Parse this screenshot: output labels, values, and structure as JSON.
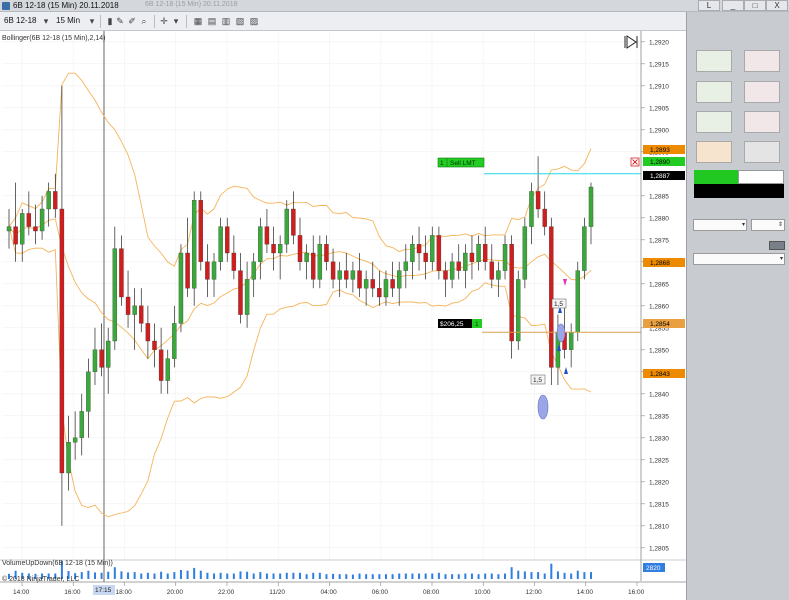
{
  "window": {
    "title": "6B 12-18 (15 Min)  20.11.2018",
    "ghost_title": "6B 12-18 (15 Min)  20.11.2018",
    "minimize": "_",
    "maximize": "□",
    "close": "X",
    "lock": "L"
  },
  "toolbar": {
    "instrument": "6B 12-18",
    "interval": "15 Min"
  },
  "chart": {
    "indicator_label": "Bollinger(6B 12-18 (15 Min),2,14)",
    "volume_label": "VolumeUpDown(6B 12-18 (15 Min))",
    "copyright": "© 2018 NinjaTrader, LLC",
    "price_axis_labels": [
      "1,2920",
      "1,2915",
      "1,2910",
      "1,2905",
      "1,2900",
      "1,2895",
      "1,2885",
      "1,2880",
      "1,2875",
      "1,2870",
      "1,2865",
      "1,2860",
      "1,2855",
      "1,2850",
      "1,2845",
      "1,2840",
      "1,2835",
      "1,2830",
      "1,2825",
      "1,2820",
      "1,2815",
      "1,2810",
      "1,2805"
    ],
    "price_markers": {
      "upper_band": "1,2893",
      "limit_order": "1,2890",
      "last_price": "1,2887",
      "middle_band": "1,2868",
      "entry_price": "1,2854",
      "lower_band": "1,2843"
    },
    "volume_axis_label": "2820",
    "time_axis_labels": [
      "14:00",
      "16:00",
      "18:00",
      "20:00",
      "22:00",
      "11/20",
      "04:00",
      "06:00",
      "08:00",
      "10:00",
      "12:00",
      "14:00",
      "16:00"
    ],
    "crosshair_time": "17:15",
    "order_label": {
      "qty": "1",
      "text": "Sell LMT"
    },
    "position_label": {
      "pnl": "$206,25",
      "qty": "1"
    },
    "exec_labels": {
      "a": "1,5",
      "b": "1,5"
    },
    "colors": {
      "up_candle": "#3aa83a",
      "down_candle": "#d01d1d",
      "band": "#f5b45a",
      "limit_line": "#20d8e8",
      "entry_line": "#d8a050",
      "volume": "#2f7ee0",
      "order_tag": "#22cc22",
      "band_tag": "#ee8a00"
    }
  },
  "chart_data": {
    "type": "candlestick",
    "instrument": "6B 12-18",
    "interval": "15 Min",
    "y_range": [
      1.2802,
      1.2922
    ],
    "x_labels": [
      "14:00",
      "16:00",
      "18:00",
      "20:00",
      "22:00",
      "11/20",
      "04:00",
      "06:00",
      "08:00",
      "10:00",
      "12:00",
      "14:00",
      "16:00"
    ],
    "candles": [
      {
        "o": 1.2877,
        "h": 1.2882,
        "l": 1.2873,
        "c": 1.2878
      },
      {
        "o": 1.2878,
        "h": 1.2888,
        "l": 1.287,
        "c": 1.2874
      },
      {
        "o": 1.2874,
        "h": 1.2882,
        "l": 1.287,
        "c": 1.2881
      },
      {
        "o": 1.2881,
        "h": 1.2886,
        "l": 1.2876,
        "c": 1.2878
      },
      {
        "o": 1.2878,
        "h": 1.2883,
        "l": 1.2874,
        "c": 1.2877
      },
      {
        "o": 1.2877,
        "h": 1.2885,
        "l": 1.2875,
        "c": 1.2882
      },
      {
        "o": 1.2882,
        "h": 1.2888,
        "l": 1.2878,
        "c": 1.2886
      },
      {
        "o": 1.2886,
        "h": 1.289,
        "l": 1.288,
        "c": 1.2882
      },
      {
        "o": 1.2882,
        "h": 1.291,
        "l": 1.281,
        "c": 1.2822
      },
      {
        "o": 1.2822,
        "h": 1.2835,
        "l": 1.2818,
        "c": 1.2829
      },
      {
        "o": 1.2829,
        "h": 1.2836,
        "l": 1.2825,
        "c": 1.283
      },
      {
        "o": 1.283,
        "h": 1.284,
        "l": 1.2826,
        "c": 1.2836
      },
      {
        "o": 1.2836,
        "h": 1.2848,
        "l": 1.283,
        "c": 1.2845
      },
      {
        "o": 1.2845,
        "h": 1.2855,
        "l": 1.2842,
        "c": 1.285
      },
      {
        "o": 1.285,
        "h": 1.2856,
        "l": 1.2844,
        "c": 1.2846
      },
      {
        "o": 1.2846,
        "h": 1.2855,
        "l": 1.284,
        "c": 1.2852
      },
      {
        "o": 1.2852,
        "h": 1.2878,
        "l": 1.285,
        "c": 1.2873
      },
      {
        "o": 1.2873,
        "h": 1.2876,
        "l": 1.286,
        "c": 1.2862
      },
      {
        "o": 1.2862,
        "h": 1.2868,
        "l": 1.2855,
        "c": 1.2858
      },
      {
        "o": 1.2858,
        "h": 1.2864,
        "l": 1.285,
        "c": 1.286
      },
      {
        "o": 1.286,
        "h": 1.2864,
        "l": 1.2854,
        "c": 1.2856
      },
      {
        "o": 1.2856,
        "h": 1.286,
        "l": 1.2848,
        "c": 1.2852
      },
      {
        "o": 1.2852,
        "h": 1.2856,
        "l": 1.2846,
        "c": 1.285
      },
      {
        "o": 1.285,
        "h": 1.2855,
        "l": 1.284,
        "c": 1.2843
      },
      {
        "o": 1.2843,
        "h": 1.285,
        "l": 1.284,
        "c": 1.2848
      },
      {
        "o": 1.2848,
        "h": 1.286,
        "l": 1.2846,
        "c": 1.2856
      },
      {
        "o": 1.2856,
        "h": 1.2874,
        "l": 1.2854,
        "c": 1.2872
      },
      {
        "o": 1.2872,
        "h": 1.288,
        "l": 1.2862,
        "c": 1.2864
      },
      {
        "o": 1.2864,
        "h": 1.2886,
        "l": 1.286,
        "c": 1.2884
      },
      {
        "o": 1.2884,
        "h": 1.2886,
        "l": 1.2868,
        "c": 1.287
      },
      {
        "o": 1.287,
        "h": 1.2874,
        "l": 1.2862,
        "c": 1.2866
      },
      {
        "o": 1.2866,
        "h": 1.2872,
        "l": 1.2862,
        "c": 1.287
      },
      {
        "o": 1.287,
        "h": 1.288,
        "l": 1.2868,
        "c": 1.2878
      },
      {
        "o": 1.2878,
        "h": 1.288,
        "l": 1.287,
        "c": 1.2872
      },
      {
        "o": 1.2872,
        "h": 1.2876,
        "l": 1.2866,
        "c": 1.2868
      },
      {
        "o": 1.2868,
        "h": 1.2872,
        "l": 1.2856,
        "c": 1.2858
      },
      {
        "o": 1.2858,
        "h": 1.287,
        "l": 1.2855,
        "c": 1.2866
      },
      {
        "o": 1.2866,
        "h": 1.2872,
        "l": 1.2862,
        "c": 1.287
      },
      {
        "o": 1.287,
        "h": 1.288,
        "l": 1.2866,
        "c": 1.2878
      },
      {
        "o": 1.2878,
        "h": 1.2882,
        "l": 1.2872,
        "c": 1.2874
      },
      {
        "o": 1.2874,
        "h": 1.2878,
        "l": 1.2868,
        "c": 1.2872
      },
      {
        "o": 1.2872,
        "h": 1.2876,
        "l": 1.2866,
        "c": 1.2874
      },
      {
        "o": 1.2874,
        "h": 1.2884,
        "l": 1.2872,
        "c": 1.2882
      },
      {
        "o": 1.2882,
        "h": 1.2886,
        "l": 1.2874,
        "c": 1.2876
      },
      {
        "o": 1.2876,
        "h": 1.288,
        "l": 1.2868,
        "c": 1.287
      },
      {
        "o": 1.287,
        "h": 1.2874,
        "l": 1.2866,
        "c": 1.2872
      },
      {
        "o": 1.2872,
        "h": 1.2876,
        "l": 1.2864,
        "c": 1.2866
      },
      {
        "o": 1.2866,
        "h": 1.2876,
        "l": 1.2864,
        "c": 1.2874
      },
      {
        "o": 1.2874,
        "h": 1.2876,
        "l": 1.2868,
        "c": 1.287
      },
      {
        "o": 1.287,
        "h": 1.2873,
        "l": 1.2864,
        "c": 1.2866
      },
      {
        "o": 1.2866,
        "h": 1.287,
        "l": 1.2862,
        "c": 1.2868
      },
      {
        "o": 1.2868,
        "h": 1.2872,
        "l": 1.2864,
        "c": 1.2866
      },
      {
        "o": 1.2866,
        "h": 1.287,
        "l": 1.2863,
        "c": 1.2868
      },
      {
        "o": 1.2868,
        "h": 1.2872,
        "l": 1.2862,
        "c": 1.2864
      },
      {
        "o": 1.2864,
        "h": 1.2868,
        "l": 1.286,
        "c": 1.2866
      },
      {
        "o": 1.2866,
        "h": 1.287,
        "l": 1.2862,
        "c": 1.2864
      },
      {
        "o": 1.2864,
        "h": 1.2868,
        "l": 1.286,
        "c": 1.2862
      },
      {
        "o": 1.2862,
        "h": 1.2868,
        "l": 1.286,
        "c": 1.2866
      },
      {
        "o": 1.2866,
        "h": 1.287,
        "l": 1.2862,
        "c": 1.2864
      },
      {
        "o": 1.2864,
        "h": 1.287,
        "l": 1.286,
        "c": 1.2868
      },
      {
        "o": 1.2868,
        "h": 1.2874,
        "l": 1.2864,
        "c": 1.287
      },
      {
        "o": 1.287,
        "h": 1.2876,
        "l": 1.2866,
        "c": 1.2874
      },
      {
        "o": 1.2874,
        "h": 1.2878,
        "l": 1.2868,
        "c": 1.2872
      },
      {
        "o": 1.2872,
        "h": 1.2876,
        "l": 1.2866,
        "c": 1.287
      },
      {
        "o": 1.287,
        "h": 1.2878,
        "l": 1.2868,
        "c": 1.2876
      },
      {
        "o": 1.2876,
        "h": 1.2878,
        "l": 1.2866,
        "c": 1.2868
      },
      {
        "o": 1.2868,
        "h": 1.287,
        "l": 1.2862,
        "c": 1.2866
      },
      {
        "o": 1.2866,
        "h": 1.2872,
        "l": 1.2864,
        "c": 1.287
      },
      {
        "o": 1.287,
        "h": 1.2874,
        "l": 1.2866,
        "c": 1.2868
      },
      {
        "o": 1.2868,
        "h": 1.2874,
        "l": 1.2864,
        "c": 1.2872
      },
      {
        "o": 1.2872,
        "h": 1.2876,
        "l": 1.2866,
        "c": 1.287
      },
      {
        "o": 1.287,
        "h": 1.2876,
        "l": 1.2868,
        "c": 1.2874
      },
      {
        "o": 1.2874,
        "h": 1.2878,
        "l": 1.2868,
        "c": 1.287
      },
      {
        "o": 1.287,
        "h": 1.2874,
        "l": 1.2864,
        "c": 1.2866
      },
      {
        "o": 1.2866,
        "h": 1.287,
        "l": 1.2862,
        "c": 1.2868
      },
      {
        "o": 1.2868,
        "h": 1.2876,
        "l": 1.2866,
        "c": 1.2874
      },
      {
        "o": 1.2874,
        "h": 1.2876,
        "l": 1.2848,
        "c": 1.2852
      },
      {
        "o": 1.2852,
        "h": 1.2868,
        "l": 1.285,
        "c": 1.2866
      },
      {
        "o": 1.2866,
        "h": 1.288,
        "l": 1.2864,
        "c": 1.2878
      },
      {
        "o": 1.2878,
        "h": 1.2888,
        "l": 1.2874,
        "c": 1.2886
      },
      {
        "o": 1.2886,
        "h": 1.2894,
        "l": 1.288,
        "c": 1.2882
      },
      {
        "o": 1.2882,
        "h": 1.2886,
        "l": 1.2876,
        "c": 1.2878
      },
      {
        "o": 1.2878,
        "h": 1.288,
        "l": 1.2842,
        "c": 1.2846
      },
      {
        "o": 1.2846,
        "h": 1.2858,
        "l": 1.2842,
        "c": 1.2854
      },
      {
        "o": 1.2854,
        "h": 1.286,
        "l": 1.2848,
        "c": 1.285
      },
      {
        "o": 1.285,
        "h": 1.2856,
        "l": 1.2846,
        "c": 1.2854
      },
      {
        "o": 1.2854,
        "h": 1.287,
        "l": 1.2852,
        "c": 1.2868
      },
      {
        "o": 1.2868,
        "h": 1.288,
        "l": 1.2866,
        "c": 1.2878
      },
      {
        "o": 1.2878,
        "h": 1.2888,
        "l": 1.2874,
        "c": 1.2887
      }
    ],
    "bollinger": {
      "period": 14,
      "std_dev": 2
    }
  }
}
